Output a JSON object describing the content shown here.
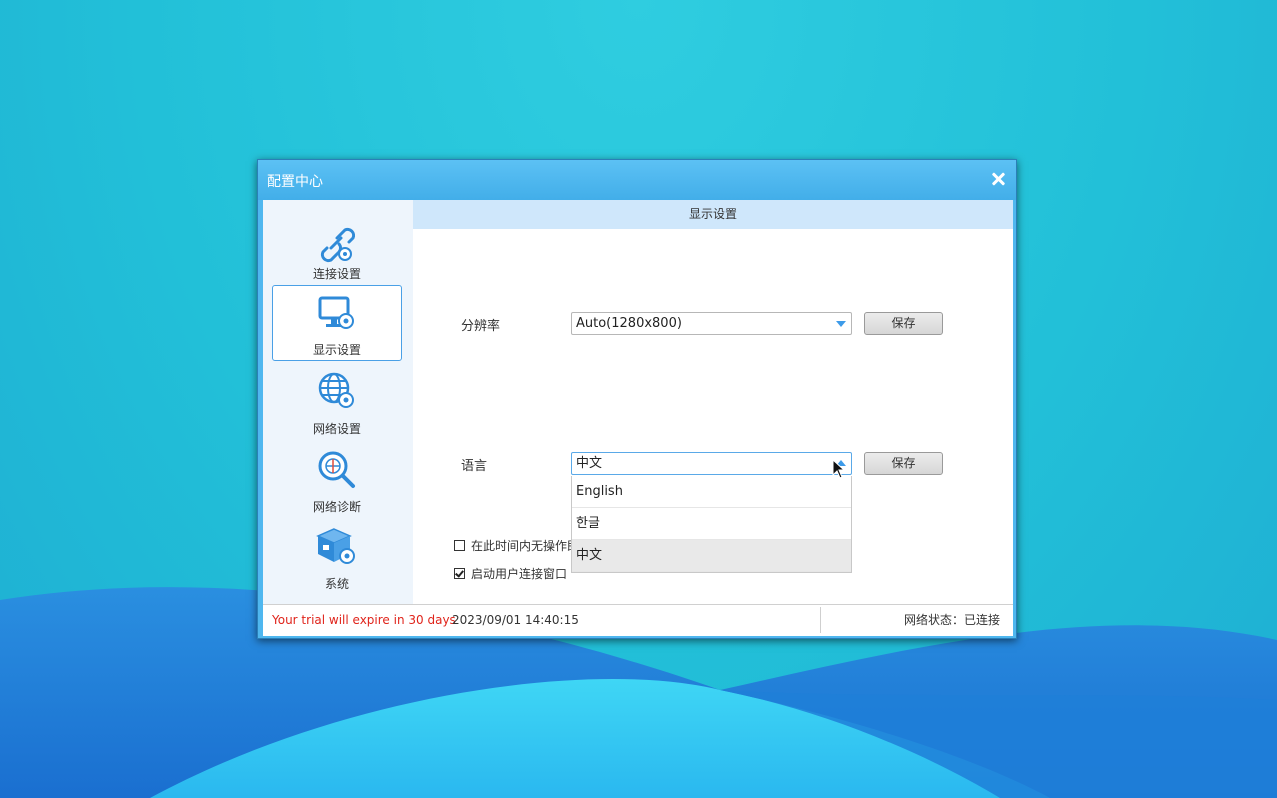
{
  "window": {
    "title": "配置中心",
    "close_icon": "close-icon"
  },
  "sidebar": {
    "items": [
      {
        "label": "连接设置",
        "icon": "link-gear-icon",
        "active": false
      },
      {
        "label": "显示设置",
        "icon": "monitor-gear-icon",
        "active": true
      },
      {
        "label": "网络设置",
        "icon": "globe-gear-icon",
        "active": false
      },
      {
        "label": "网络诊断",
        "icon": "magnifier-globe-icon",
        "active": false
      },
      {
        "label": "系统",
        "icon": "box-gear-icon",
        "active": false
      }
    ]
  },
  "main": {
    "header": "显示设置",
    "resolution": {
      "label": "分辨率",
      "value": "Auto(1280x800)",
      "save_label": "保存"
    },
    "language": {
      "label": "语言",
      "value": "中文",
      "save_label": "保存",
      "options": [
        "English",
        "한글",
        "中文"
      ],
      "selected": "中文"
    },
    "idle_checkbox": {
      "label": "在此时间内无操作即",
      "checked": false
    },
    "startup_checkbox": {
      "label": "启动用户连接窗口",
      "checked": true
    }
  },
  "status": {
    "trial": "Your trial will expire in 30 days",
    "datetime": "2023/09/01 14:40:15",
    "network": "网络状态：已连接"
  },
  "colors": {
    "accent": "#4fb7ef",
    "trial_text": "#e0241b",
    "header_bg": "#cfe7fb"
  }
}
